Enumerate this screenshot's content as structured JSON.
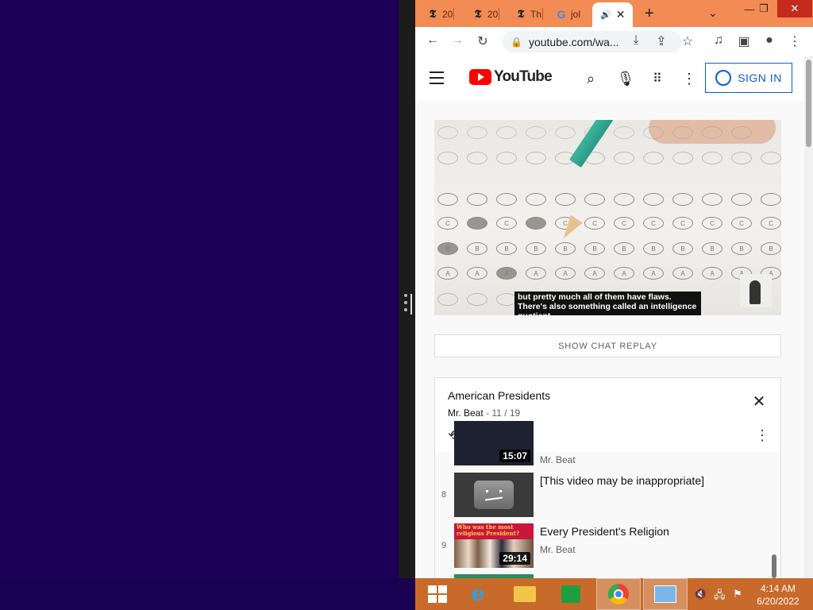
{
  "browser": {
    "tabs": [
      {
        "label": "20",
        "icon": "nyt-icon"
      },
      {
        "label": "20",
        "icon": "nyt-icon"
      },
      {
        "label": "Th",
        "icon": "nyt-icon"
      },
      {
        "label": "jol",
        "icon": "google-icon"
      },
      {
        "label": "",
        "icon": "youtube-audio-icon",
        "active": true
      }
    ],
    "url": "youtube.com/wa...",
    "accent": "#f28b54"
  },
  "youtube": {
    "logo_text": "YouTube",
    "sign_in": "SIGN IN",
    "caption": "but pretty much all of them have flaws. There's also something called an intelligence quotient,",
    "show_chat_replay": "SHOW CHAT REPLAY",
    "playlist": {
      "title": "American Presidents",
      "owner": "Mr. Beat",
      "position": "11 / 19",
      "items": [
        {
          "index": "",
          "title": "",
          "channel": "Mr. Beat",
          "duration": "15:07"
        },
        {
          "index": "8",
          "title": "[This video may be inappropriate]",
          "channel": "",
          "duration": ""
        },
        {
          "index": "9",
          "title": "Every President's Religion",
          "channel": "Mr. Beat",
          "duration": "29:14",
          "thumb_text": "Who was the most religious President?"
        }
      ]
    }
  },
  "taskbar": {
    "time": "4:14 AM",
    "date": "6/20/2022"
  }
}
